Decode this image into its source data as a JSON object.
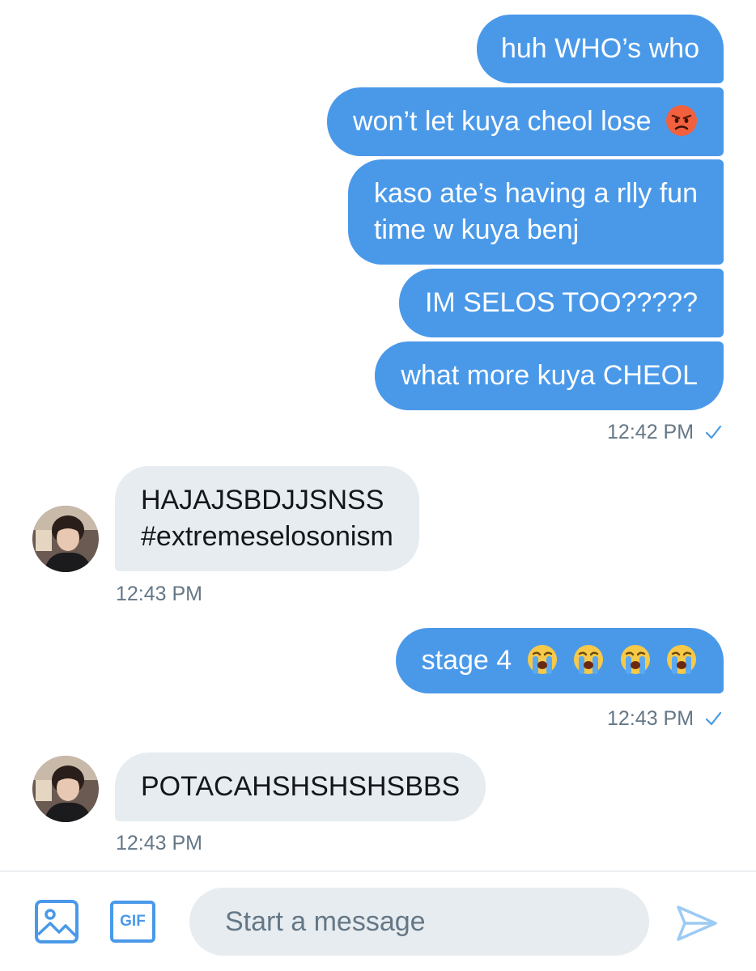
{
  "messages": [
    {
      "id": "m1",
      "direction": "outgoing",
      "text": "huh WHO’s who"
    },
    {
      "id": "m2",
      "direction": "outgoing",
      "text": "won’t let kuya cheol lose",
      "emoji": "pouting-face"
    },
    {
      "id": "m3",
      "direction": "outgoing",
      "lines": [
        "kaso ate’s having a rlly fun",
        "time w kuya benj"
      ]
    },
    {
      "id": "m4",
      "direction": "outgoing",
      "text": "IM SELOS TOO?????"
    },
    {
      "id": "m5",
      "direction": "outgoing",
      "text": "what more kuya CHEOL",
      "timestamp": "12:42 PM",
      "read": true
    },
    {
      "id": "m6",
      "direction": "incoming",
      "lines": [
        "HAJAJSBDJJSNSS",
        "#extremeselosonism"
      ],
      "timestamp": "12:43 PM"
    },
    {
      "id": "m7",
      "direction": "outgoing",
      "text": "stage 4",
      "emoji": [
        "loudly-crying-face",
        "loudly-crying-face",
        "loudly-crying-face",
        "loudly-crying-face"
      ],
      "timestamp": "12:43 PM",
      "read": true
    },
    {
      "id": "m8",
      "direction": "incoming",
      "text": "POTACAHSHSHSHSBBS",
      "timestamp": "12:43 PM"
    }
  ],
  "composer": {
    "placeholder": "Start a message",
    "gif_label": "GIF",
    "icons": [
      "image-icon",
      "gif-icon",
      "send-icon"
    ]
  },
  "colors": {
    "outgoing_bubble": "#4a99e9",
    "incoming_bubble": "#e6ecf0",
    "timestamp": "#657786",
    "accent": "#1da1f2"
  }
}
